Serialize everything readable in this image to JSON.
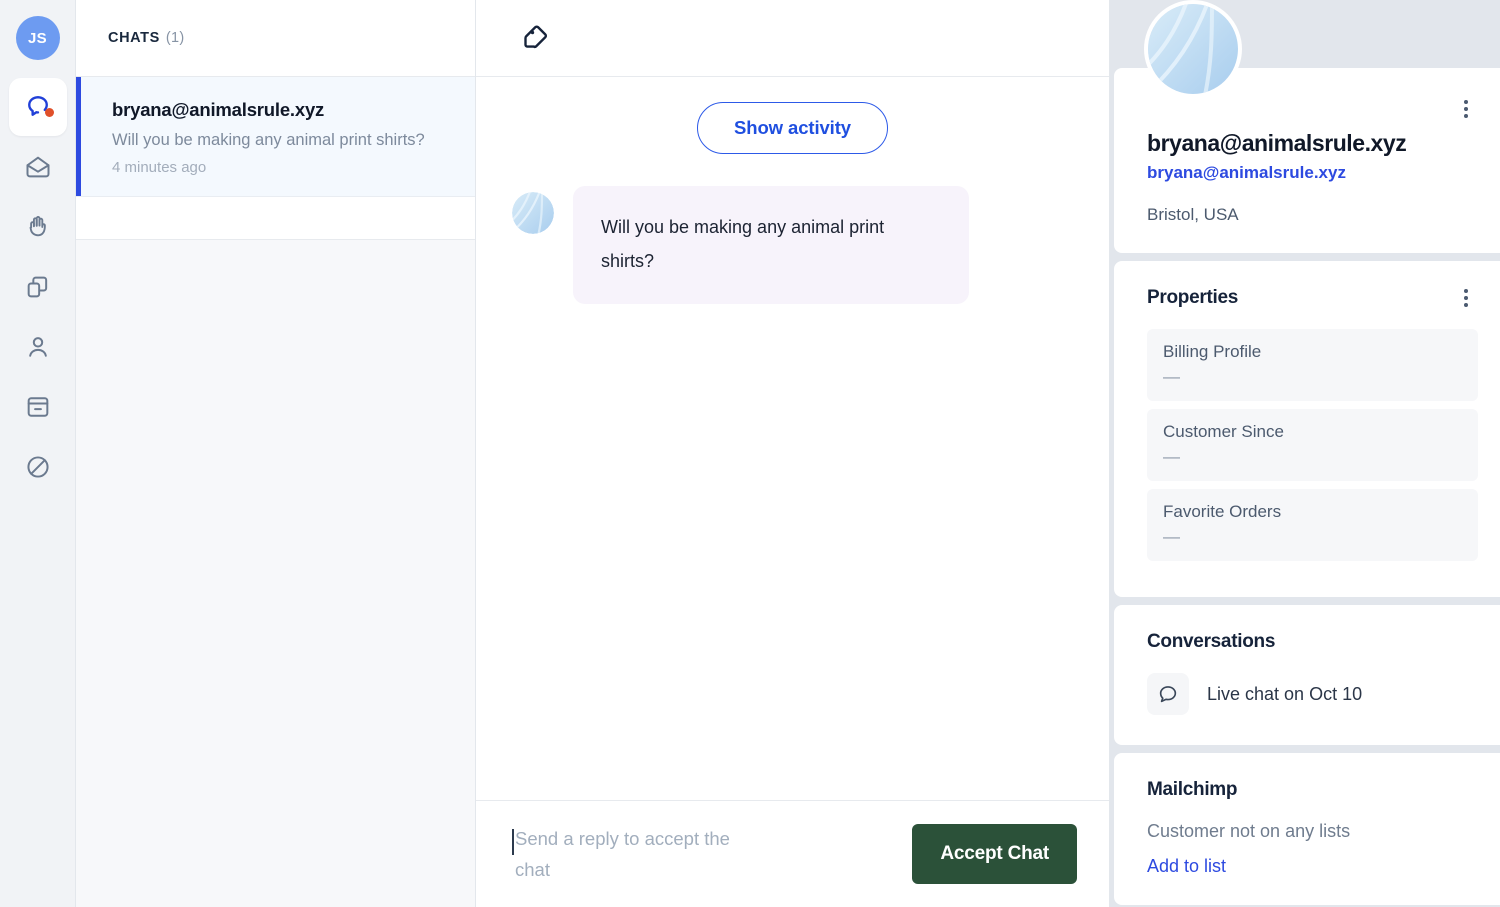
{
  "rail": {
    "avatar_initials": "JS",
    "items": [
      {
        "icon": "chat-bubble-icon",
        "name": "chats",
        "active": true,
        "badge": true
      },
      {
        "icon": "open-envelope-icon",
        "name": "inbox",
        "active": false,
        "badge": false
      },
      {
        "icon": "waving-hand-icon",
        "name": "greetings",
        "active": false,
        "badge": false
      },
      {
        "icon": "copy-pages-icon",
        "name": "canned-responses",
        "active": false,
        "badge": false
      },
      {
        "icon": "person-icon",
        "name": "customers",
        "active": false,
        "badge": false
      },
      {
        "icon": "archive-box-icon",
        "name": "archives",
        "active": false,
        "badge": false
      },
      {
        "icon": "ban-circle-icon",
        "name": "banned",
        "active": false,
        "badge": false
      }
    ]
  },
  "chat_list": {
    "header_title": "CHATS",
    "header_count": "(1)",
    "items": [
      {
        "name": "bryana@animalsrule.xyz",
        "preview": "Will you be making any animal print shirts?",
        "time": "4 minutes ago",
        "selected": true
      }
    ]
  },
  "conversation": {
    "header_icon": "tag-icon",
    "show_activity_label": "Show activity",
    "messages": [
      {
        "author": "bryana@animalsrule.xyz",
        "text": "Will you be making any animal print shirts?",
        "side": "incoming"
      }
    ],
    "composer_placeholder": "Send a reply to accept the chat",
    "composer_value": "",
    "accept_button_label": "Accept Chat"
  },
  "details": {
    "profile": {
      "name": "bryana@animalsrule.xyz",
      "email": "bryana@animalsrule.xyz",
      "location": "Bristol, USA"
    },
    "properties": {
      "title": "Properties",
      "rows": [
        {
          "label": "Billing Profile",
          "value": "—"
        },
        {
          "label": "Customer Since",
          "value": "—"
        },
        {
          "label": "Favorite Orders",
          "value": "—"
        }
      ]
    },
    "conversations": {
      "title": "Conversations",
      "items": [
        {
          "icon": "chat-bubble-outline-icon",
          "label": "Live chat on Oct 10"
        }
      ]
    },
    "mailchimp": {
      "title": "Mailchimp",
      "note": "Customer not on any lists",
      "link": "Add to list"
    }
  },
  "colors": {
    "accent_blue": "#2d4ae0",
    "accept_green": "#2b5139",
    "avatar_blue": "#6d9bf1",
    "badge_red": "#e0502a",
    "bubble_lavender": "#f7f3fb"
  }
}
